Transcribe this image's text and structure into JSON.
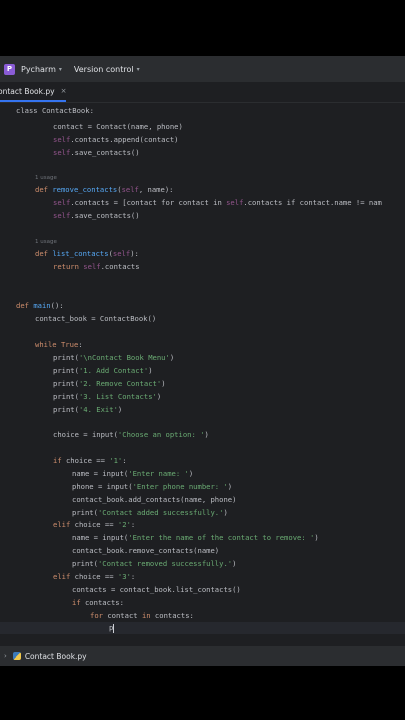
{
  "titlebar": {
    "app_icon_letter": "P",
    "app_name": "Pycharm",
    "vcs_label": "Version control"
  },
  "tab": {
    "label": "ontact Book.py",
    "close": "×"
  },
  "editor": {
    "usage_hint": "1 usage",
    "lines": {
      "l1": "class ContactBook:",
      "l2": "contact = Contact(name, phone)",
      "l3a": "self",
      "l3b": ".contacts.append(contact)",
      "l4a": "self",
      "l4b": ".save_contacts()",
      "l6a": "def ",
      "l6b": "remove_contacts",
      "l6c": "(",
      "l6d": "self",
      "l6e": ", name):",
      "l7a": "self",
      "l7b": ".contacts = [contact for contact in ",
      "l7c": "self",
      "l7d": ".contacts if contact.name != nam",
      "l8a": "self",
      "l8b": ".save_contacts()",
      "l10a": "def ",
      "l10b": "list_contacts",
      "l10c": "(",
      "l10d": "self",
      "l10e": "):",
      "l11a": "return ",
      "l11b": "self",
      "l11c": ".contacts",
      "l13a": "def ",
      "l13b": "main",
      "l13c": "():",
      "l14": "contact_book = ContactBook()",
      "l15a": "while ",
      "l15b": "True",
      "l15c": ":",
      "l16a": "print(",
      "l16b": "'\\nContact Book Menu'",
      "l16c": ")",
      "l17a": "print(",
      "l17b": "'1. Add Contact'",
      "l17c": ")",
      "l18a": "print(",
      "l18b": "'2. Remove Contact'",
      "l18c": ")",
      "l19a": "print(",
      "l19b": "'3. List Contacts'",
      "l19c": ")",
      "l20a": "print(",
      "l20b": "'4. Exit'",
      "l20c": ")",
      "l21a": "choice = input(",
      "l21b": "'Choose an option: '",
      "l21c": ")",
      "l22a": "if ",
      "l22b": "choice == ",
      "l22c": "'1'",
      "l22d": ":",
      "l23a": "name = input(",
      "l23b": "'Enter name: '",
      "l23c": ")",
      "l24a": "phone = input(",
      "l24b": "'Enter phone number: '",
      "l24c": ")",
      "l25": "contact_book.add_contacts(name, phone)",
      "l26a": "print(",
      "l26b": "'Contact added successfully.'",
      "l26c": ")",
      "l27a": "elif ",
      "l27b": "choice == ",
      "l27c": "'2'",
      "l27d": ":",
      "l28a": "name = input(",
      "l28b": "'Enter the name of the contact to remove: '",
      "l28c": ")",
      "l29": "contact_book.remove_contacts(name)",
      "l30a": "print(",
      "l30b": "'Contact removed successfully.'",
      "l30c": ")",
      "l31a": "elif ",
      "l31b": "choice == ",
      "l31c": "'3'",
      "l31d": ":",
      "l32": "contacts = contact_book.list_contacts()",
      "l33a": "if ",
      "l33b": "contacts:",
      "l34a": "for ",
      "l34b": "contact ",
      "l34c": "in ",
      "l34d": "contacts:",
      "l35": "p"
    }
  },
  "statusbar": {
    "chevron": "›",
    "file_label": "Contact Book.py"
  }
}
